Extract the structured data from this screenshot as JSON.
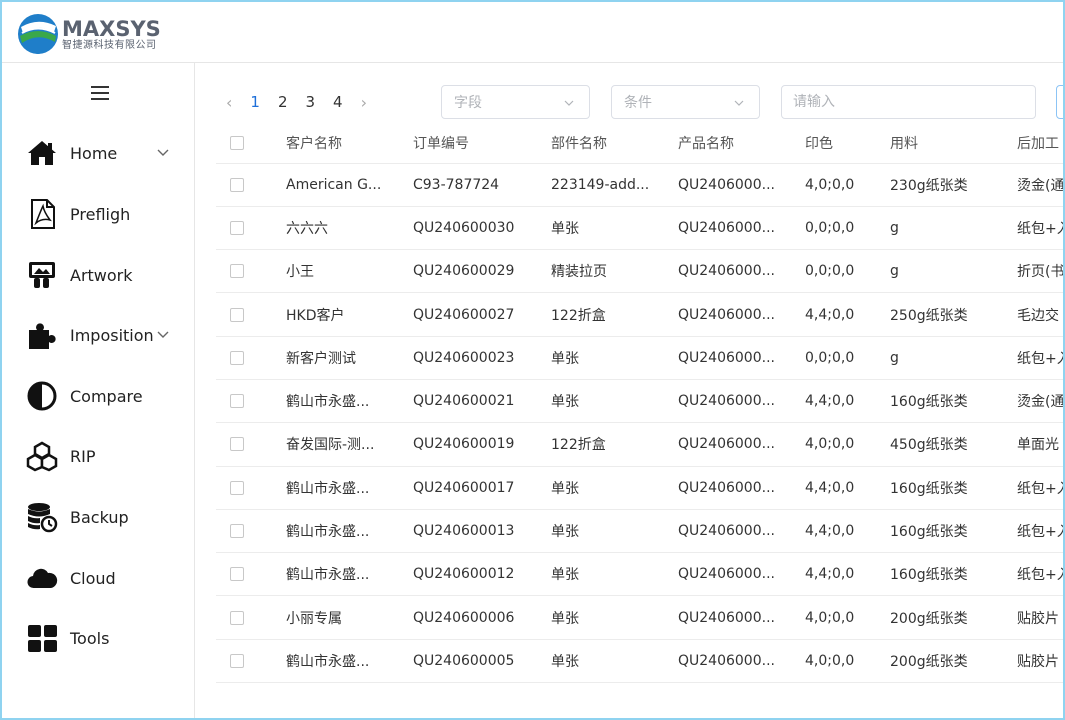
{
  "brand": {
    "name": "MAXSYS",
    "subtitle": "智捷源科技有限公司",
    "colors": {
      "blue": "#1f7ec9",
      "green": "#3aa84a",
      "gray": "#5a6270"
    }
  },
  "sidebar": {
    "menu_icon": "hamburger-icon",
    "items": [
      {
        "label": "Home",
        "icon": "home-icon",
        "has_chevron": true
      },
      {
        "label": "Prefligh",
        "icon": "pdf-icon",
        "has_chevron": false
      },
      {
        "label": "Artwork",
        "icon": "artwork-icon",
        "has_chevron": false
      },
      {
        "label": "Imposition",
        "icon": "puzzle-icon",
        "has_chevron": true
      },
      {
        "label": "Compare",
        "icon": "contrast-icon",
        "has_chevron": false
      },
      {
        "label": "RIP",
        "icon": "cubes-icon",
        "has_chevron": false
      },
      {
        "label": "Backup",
        "icon": "database-restore-icon",
        "has_chevron": false
      },
      {
        "label": "Cloud",
        "icon": "cloud-icon",
        "has_chevron": false
      },
      {
        "label": "Tools",
        "icon": "grid-icon",
        "has_chevron": false
      }
    ]
  },
  "toolbar": {
    "pagination": {
      "prev": "‹",
      "pages": [
        "1",
        "2",
        "3",
        "4"
      ],
      "active_page": "1",
      "next": "›"
    },
    "field_select": {
      "placeholder": "字段"
    },
    "condition_select": {
      "placeholder": "条件"
    },
    "search": {
      "placeholder": "请输入",
      "value": ""
    }
  },
  "table": {
    "headers": [
      "客户名称",
      "订单编号",
      "部件名称",
      "产品名称",
      "印色",
      "用料",
      "后加工"
    ],
    "rows": [
      [
        "American G...",
        "C93-787724",
        "223149-add...",
        "QU2406000...",
        "4,0;0,0",
        "230g纸张类",
        "烫金(通"
      ],
      [
        "六六六",
        "QU240600030",
        "单张",
        "QU2406000...",
        "0,0;0,0",
        "g",
        "纸包+入"
      ],
      [
        "小王",
        "QU240600029",
        "精装拉页",
        "QU2406000...",
        "0,0;0,0",
        "g",
        "折页(书"
      ],
      [
        "HKD客户",
        "QU240600027",
        "122折盒",
        "QU2406000...",
        "4,4;0,0",
        "250g纸张类",
        "毛边交"
      ],
      [
        "新客户测试",
        "QU240600023",
        "单张",
        "QU2406000...",
        "0,0;0,0",
        "g",
        "纸包+入"
      ],
      [
        "鹤山市永盛...",
        "QU240600021",
        "单张",
        "QU2406000...",
        "4,4;0,0",
        "160g纸张类",
        "烫金(通"
      ],
      [
        "奋发国际-测...",
        "QU240600019",
        "122折盒",
        "QU2406000...",
        "4,0;0,0",
        "450g纸张类",
        "单面光"
      ],
      [
        "鹤山市永盛...",
        "QU240600017",
        "单张",
        "QU2406000...",
        "4,4;0,0",
        "160g纸张类",
        "纸包+入"
      ],
      [
        "鹤山市永盛...",
        "QU240600013",
        "单张",
        "QU2406000...",
        "4,4;0,0",
        "160g纸张类",
        "纸包+入"
      ],
      [
        "鹤山市永盛...",
        "QU240600012",
        "单张",
        "QU2406000...",
        "4,4;0,0",
        "160g纸张类",
        "纸包+入"
      ],
      [
        "小丽专属",
        "QU240600006",
        "单张",
        "QU2406000...",
        "4,0;0,0",
        "200g纸张类",
        "贴胶片"
      ],
      [
        "鹤山市永盛...",
        "QU240600005",
        "单张",
        "QU2406000...",
        "4,0;0,0",
        "200g纸张类",
        "贴胶片"
      ]
    ]
  }
}
